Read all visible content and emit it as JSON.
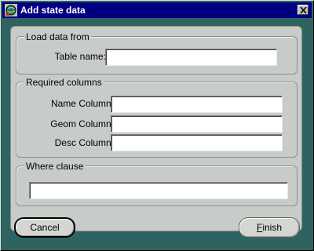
{
  "window": {
    "title": "Add state data",
    "icon": "globe-app-icon",
    "close_icon": "close-icon"
  },
  "load_group": {
    "title": "Load data from",
    "table_name_label": "Table name:",
    "table_name_value": ""
  },
  "columns_group": {
    "title": "Required columns",
    "name_label": "Name Column:",
    "name_value": "",
    "geom_label": "Geom Column:",
    "geom_value": "",
    "desc_label": "Desc Column:",
    "desc_value": ""
  },
  "where_group": {
    "title": "Where clause",
    "value": ""
  },
  "buttons": {
    "cancel_label": "Cancel",
    "finish_prefix": "",
    "finish_mnemonic": "F",
    "finish_rest": "inish"
  },
  "colors": {
    "desktop": "#2f6360",
    "titlebar": "#000080",
    "panel": "#c8ccc8"
  }
}
